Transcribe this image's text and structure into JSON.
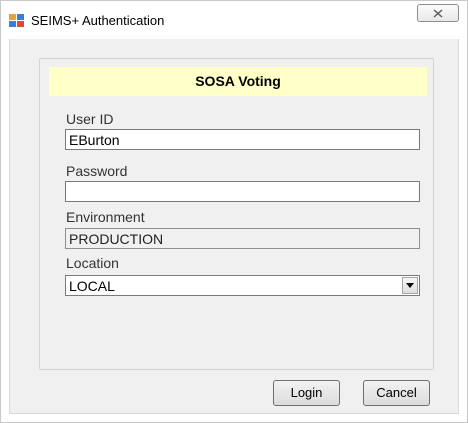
{
  "window": {
    "title": "SEIMS+ Authentication"
  },
  "banner": {
    "text": "SOSA Voting"
  },
  "fields": {
    "user_id": {
      "label": "User ID",
      "value": "EBurton"
    },
    "password": {
      "label": "Password",
      "value": ""
    },
    "environment": {
      "label": "Environment",
      "value": "PRODUCTION"
    },
    "location": {
      "label": "Location",
      "value": "LOCAL"
    }
  },
  "buttons": {
    "login": "Login",
    "cancel": "Cancel"
  },
  "icons": {
    "app": "app-window-icon",
    "close": "close-icon",
    "dropdown": "chevron-down-icon"
  },
  "colors": {
    "banner_background": "#ffffc8",
    "dialog_background": "#f0f0f0"
  }
}
